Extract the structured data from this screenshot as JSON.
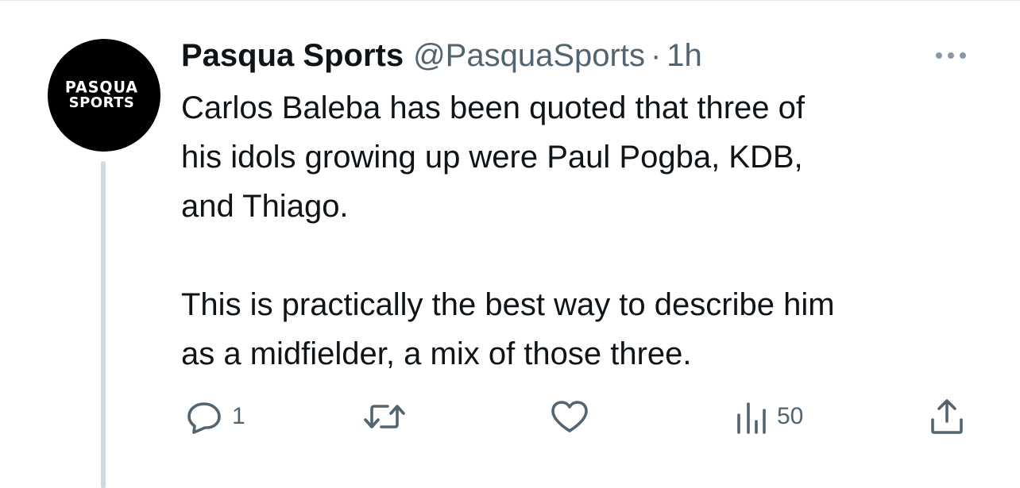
{
  "author": {
    "display_name": "Pasqua Sports",
    "handle": "@PasquaSports",
    "separator": "·",
    "timestamp": "1h",
    "avatar_text_line1": "PASQUA",
    "avatar_text_line2": "SPORTS"
  },
  "tweet": {
    "text": "Carlos Baleba has been quoted that three of\nhis idols growing up were Paul Pogba, KDB,\nand Thiago.\n\nThis is practically the best way to describe him\nas a midfielder, a mix of those three."
  },
  "actions": {
    "reply_count": "1",
    "retweet_count": "",
    "like_count": "",
    "views_count": "50"
  },
  "icons": {
    "more": "more-horizontal-icon",
    "reply": "reply-icon",
    "retweet": "retweet-icon",
    "like": "heart-icon",
    "views": "views-icon",
    "share": "share-icon"
  },
  "colors": {
    "text_primary": "#0f1419",
    "text_secondary": "#536471",
    "thread_line": "#cfd9de",
    "avatar_bg": "#000000"
  }
}
